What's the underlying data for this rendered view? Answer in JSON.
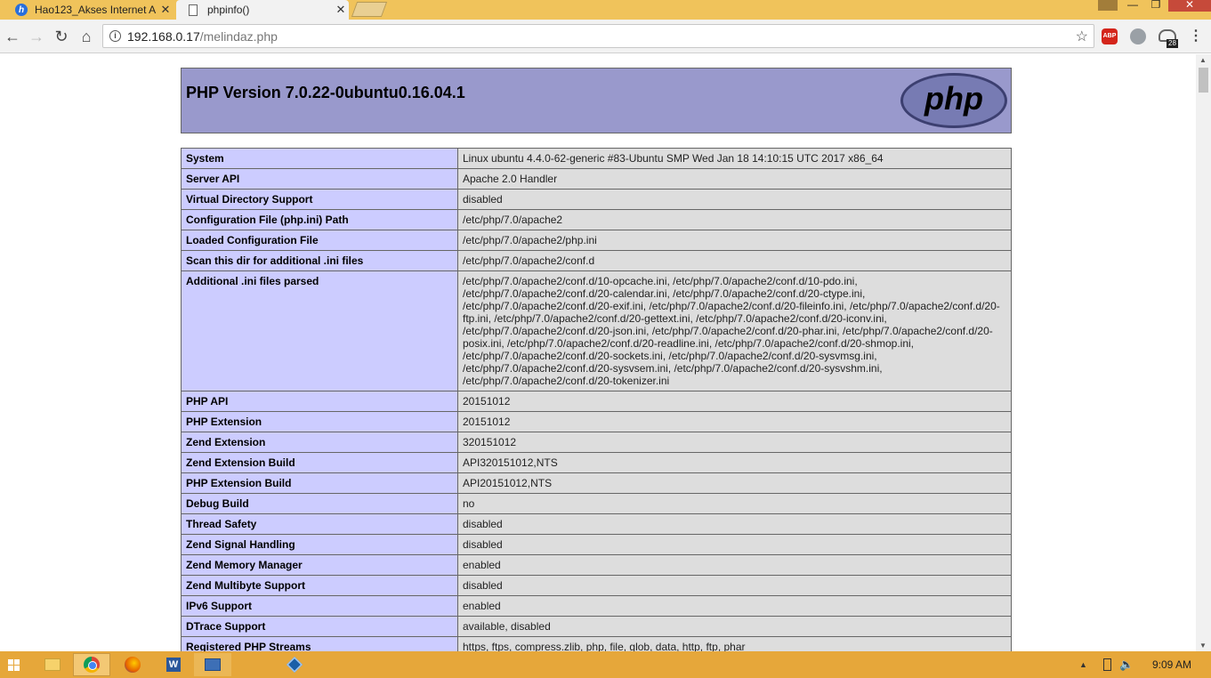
{
  "browser": {
    "tabs": [
      {
        "title": "Hao123_Akses Internet A",
        "icon": "hao123-icon"
      },
      {
        "title": "phpinfo()",
        "icon": "page-icon"
      }
    ],
    "url_host": "192.168.0.17",
    "url_path": "/melindaz.php",
    "abp_label": "ABP",
    "ext_badge": "28"
  },
  "php": {
    "title": "PHP Version 7.0.22-0ubuntu0.16.04.1",
    "logo_text": "php"
  },
  "info_rows": [
    {
      "k": "System",
      "v": "Linux ubuntu 4.4.0-62-generic #83-Ubuntu SMP Wed Jan 18 14:10:15 UTC 2017 x86_64"
    },
    {
      "k": "Server API",
      "v": "Apache 2.0 Handler"
    },
    {
      "k": "Virtual Directory Support",
      "v": "disabled"
    },
    {
      "k": "Configuration File (php.ini) Path",
      "v": "/etc/php/7.0/apache2"
    },
    {
      "k": "Loaded Configuration File",
      "v": "/etc/php/7.0/apache2/php.ini"
    },
    {
      "k": "Scan this dir for additional .ini files",
      "v": "/etc/php/7.0/apache2/conf.d"
    },
    {
      "k": "Additional .ini files parsed",
      "v": "/etc/php/7.0/apache2/conf.d/10-opcache.ini, /etc/php/7.0/apache2/conf.d/10-pdo.ini, /etc/php/7.0/apache2/conf.d/20-calendar.ini, /etc/php/7.0/apache2/conf.d/20-ctype.ini, /etc/php/7.0/apache2/conf.d/20-exif.ini, /etc/php/7.0/apache2/conf.d/20-fileinfo.ini, /etc/php/7.0/apache2/conf.d/20-ftp.ini, /etc/php/7.0/apache2/conf.d/20-gettext.ini, /etc/php/7.0/apache2/conf.d/20-iconv.ini, /etc/php/7.0/apache2/conf.d/20-json.ini, /etc/php/7.0/apache2/conf.d/20-phar.ini, /etc/php/7.0/apache2/conf.d/20-posix.ini, /etc/php/7.0/apache2/conf.d/20-readline.ini, /etc/php/7.0/apache2/conf.d/20-shmop.ini, /etc/php/7.0/apache2/conf.d/20-sockets.ini, /etc/php/7.0/apache2/conf.d/20-sysvmsg.ini, /etc/php/7.0/apache2/conf.d/20-sysvsem.ini, /etc/php/7.0/apache2/conf.d/20-sysvshm.ini, /etc/php/7.0/apache2/conf.d/20-tokenizer.ini"
    },
    {
      "k": "PHP API",
      "v": "20151012"
    },
    {
      "k": "PHP Extension",
      "v": "20151012"
    },
    {
      "k": "Zend Extension",
      "v": "320151012"
    },
    {
      "k": "Zend Extension Build",
      "v": "API320151012,NTS"
    },
    {
      "k": "PHP Extension Build",
      "v": "API20151012,NTS"
    },
    {
      "k": "Debug Build",
      "v": "no"
    },
    {
      "k": "Thread Safety",
      "v": "disabled"
    },
    {
      "k": "Zend Signal Handling",
      "v": "disabled"
    },
    {
      "k": "Zend Memory Manager",
      "v": "enabled"
    },
    {
      "k": "Zend Multibyte Support",
      "v": "disabled"
    },
    {
      "k": "IPv6 Support",
      "v": "enabled"
    },
    {
      "k": "DTrace Support",
      "v": "available, disabled"
    },
    {
      "k": "Registered PHP Streams",
      "v": "https, ftps, compress.zlib, php, file, glob, data, http, ftp, phar"
    }
  ],
  "taskbar": {
    "clock": "9:09 AM",
    "apps": [
      "start-icon",
      "file-explorer-icon",
      "chrome-icon",
      "firefox-icon",
      "word-icon",
      "files-icon",
      "virtualbox-icon"
    ]
  },
  "colors": {
    "tabstrip": "#f0c35b",
    "php_header": "#9999cc",
    "key_cell": "#ccccff",
    "value_cell": "#dddddd",
    "taskbar": "#e6a73a"
  }
}
